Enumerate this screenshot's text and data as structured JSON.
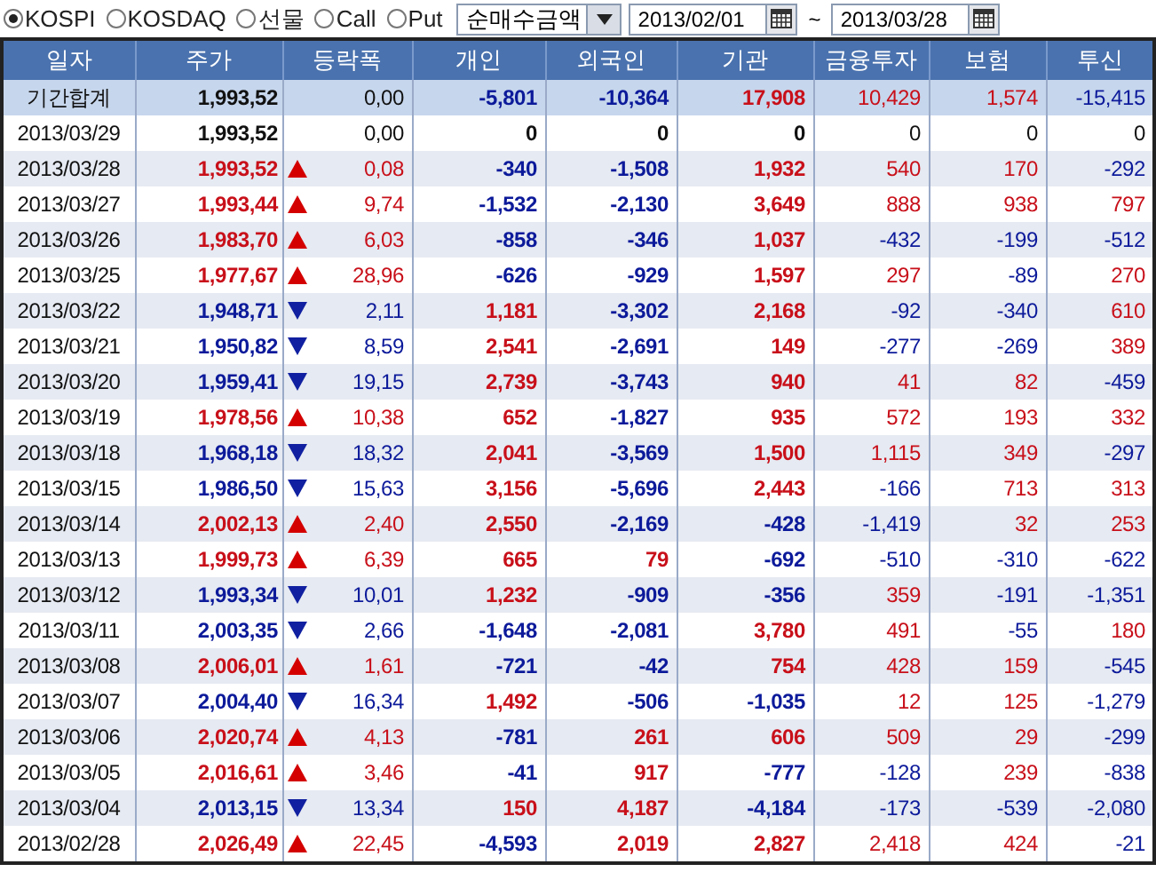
{
  "toolbar": {
    "markets": [
      {
        "label": "KOSPI",
        "selected": true
      },
      {
        "label": "KOSDAQ",
        "selected": false
      },
      {
        "label": "선물",
        "selected": false
      },
      {
        "label": "Call",
        "selected": false
      },
      {
        "label": "Put",
        "selected": false
      }
    ],
    "measure": {
      "value": "순매수금액"
    },
    "date_from": "2013/02/01",
    "range_separator": "~",
    "date_to": "2013/03/28"
  },
  "table": {
    "columns": [
      "일자",
      "주가",
      "등락폭",
      "개인",
      "외국인",
      "기관",
      "금융투자",
      "보험",
      "투신"
    ],
    "rows": [
      {
        "kind": "total",
        "rising": false,
        "falling": false,
        "cells": [
          "기간합계",
          "1,993,52",
          "0,00",
          "-5,801",
          "-10,364",
          "17,908",
          "10,429",
          "1,574",
          "-15,415"
        ]
      },
      {
        "kind": "day",
        "rising": false,
        "falling": false,
        "cells": [
          "2013/03/29",
          "1,993,52",
          "0,00",
          "0",
          "0",
          "0",
          "0",
          "0",
          "0"
        ]
      },
      {
        "kind": "day",
        "rising": true,
        "falling": false,
        "cells": [
          "2013/03/28",
          "1,993,52",
          "0,08",
          "-340",
          "-1,508",
          "1,932",
          "540",
          "170",
          "-292"
        ]
      },
      {
        "kind": "day",
        "rising": true,
        "falling": false,
        "cells": [
          "2013/03/27",
          "1,993,44",
          "9,74",
          "-1,532",
          "-2,130",
          "3,649",
          "888",
          "938",
          "797"
        ]
      },
      {
        "kind": "day",
        "rising": true,
        "falling": false,
        "cells": [
          "2013/03/26",
          "1,983,70",
          "6,03",
          "-858",
          "-346",
          "1,037",
          "-432",
          "-199",
          "-512"
        ]
      },
      {
        "kind": "day",
        "rising": true,
        "falling": false,
        "cells": [
          "2013/03/25",
          "1,977,67",
          "28,96",
          "-626",
          "-929",
          "1,597",
          "297",
          "-89",
          "270"
        ]
      },
      {
        "kind": "day",
        "rising": false,
        "falling": true,
        "cells": [
          "2013/03/22",
          "1,948,71",
          "2,11",
          "1,181",
          "-3,302",
          "2,168",
          "-92",
          "-340",
          "610"
        ]
      },
      {
        "kind": "day",
        "rising": false,
        "falling": true,
        "cells": [
          "2013/03/21",
          "1,950,82",
          "8,59",
          "2,541",
          "-2,691",
          "149",
          "-277",
          "-269",
          "389"
        ]
      },
      {
        "kind": "day",
        "rising": false,
        "falling": true,
        "cells": [
          "2013/03/20",
          "1,959,41",
          "19,15",
          "2,739",
          "-3,743",
          "940",
          "41",
          "82",
          "-459"
        ]
      },
      {
        "kind": "day",
        "rising": true,
        "falling": false,
        "cells": [
          "2013/03/19",
          "1,978,56",
          "10,38",
          "652",
          "-1,827",
          "935",
          "572",
          "193",
          "332"
        ]
      },
      {
        "kind": "day",
        "rising": false,
        "falling": true,
        "cells": [
          "2013/03/18",
          "1,968,18",
          "18,32",
          "2,041",
          "-3,569",
          "1,500",
          "1,115",
          "349",
          "-297"
        ]
      },
      {
        "kind": "day",
        "rising": false,
        "falling": true,
        "cells": [
          "2013/03/15",
          "1,986,50",
          "15,63",
          "3,156",
          "-5,696",
          "2,443",
          "-166",
          "713",
          "313"
        ]
      },
      {
        "kind": "day",
        "rising": true,
        "falling": false,
        "cells": [
          "2013/03/14",
          "2,002,13",
          "2,40",
          "2,550",
          "-2,169",
          "-428",
          "-1,419",
          "32",
          "253"
        ]
      },
      {
        "kind": "day",
        "rising": true,
        "falling": false,
        "cells": [
          "2013/03/13",
          "1,999,73",
          "6,39",
          "665",
          "79",
          "-692",
          "-510",
          "-310",
          "-622"
        ]
      },
      {
        "kind": "day",
        "rising": false,
        "falling": true,
        "cells": [
          "2013/03/12",
          "1,993,34",
          "10,01",
          "1,232",
          "-909",
          "-356",
          "359",
          "-191",
          "-1,351"
        ]
      },
      {
        "kind": "day",
        "rising": false,
        "falling": true,
        "cells": [
          "2013/03/11",
          "2,003,35",
          "2,66",
          "-1,648",
          "-2,081",
          "3,780",
          "491",
          "-55",
          "180"
        ]
      },
      {
        "kind": "day",
        "rising": true,
        "falling": false,
        "cells": [
          "2013/03/08",
          "2,006,01",
          "1,61",
          "-721",
          "-42",
          "754",
          "428",
          "159",
          "-545"
        ]
      },
      {
        "kind": "day",
        "rising": false,
        "falling": true,
        "cells": [
          "2013/03/07",
          "2,004,40",
          "16,34",
          "1,492",
          "-506",
          "-1,035",
          "12",
          "125",
          "-1,279"
        ]
      },
      {
        "kind": "day",
        "rising": true,
        "falling": false,
        "cells": [
          "2013/03/06",
          "2,020,74",
          "4,13",
          "-781",
          "261",
          "606",
          "509",
          "29",
          "-299"
        ]
      },
      {
        "kind": "day",
        "rising": true,
        "falling": false,
        "cells": [
          "2013/03/05",
          "2,016,61",
          "3,46",
          "-41",
          "917",
          "-777",
          "-128",
          "239",
          "-838"
        ]
      },
      {
        "kind": "day",
        "rising": false,
        "falling": true,
        "cells": [
          "2013/03/04",
          "2,013,15",
          "13,34",
          "150",
          "4,187",
          "-4,184",
          "-173",
          "-539",
          "-2,080"
        ]
      },
      {
        "kind": "day",
        "rising": true,
        "falling": false,
        "cells": [
          "2013/02/28",
          "2,026,49",
          "22,45",
          "-4,593",
          "2,019",
          "2,827",
          "2,418",
          "424",
          "-21"
        ]
      }
    ]
  }
}
